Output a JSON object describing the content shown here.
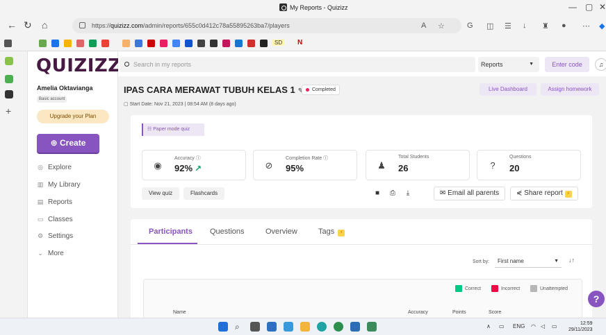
{
  "browser": {
    "window_title": "My Reports - Quizizz",
    "url_prefix": "https://",
    "url_host": "quizizz.com",
    "url_path": "/admin/reports/655c0d412c78a55895263ba7/players",
    "bookmark_sd": "SD",
    "bookmark_n": "N"
  },
  "sidebar": {
    "logo": "QUIZIZZ",
    "username": "Amelia Oktavianga",
    "account_type": "Basic account",
    "upgrade_label": "Upgrade your Plan",
    "create_label": "Create",
    "nav": [
      {
        "label": "Explore",
        "icon": "compass-icon"
      },
      {
        "label": "My Library",
        "icon": "library-icon"
      },
      {
        "label": "Reports",
        "icon": "reports-icon"
      },
      {
        "label": "Classes",
        "icon": "classes-icon"
      },
      {
        "label": "Settings",
        "icon": "gear-icon"
      },
      {
        "label": "More",
        "icon": "chevron-down-icon"
      }
    ]
  },
  "topbar": {
    "search_placeholder": "Search in my reports",
    "scope_value": "Reports",
    "enter_code_label": "Enter code"
  },
  "report": {
    "title": "IPAS CARA MERAWAT TUBUH KELAS 1",
    "status": "Completed",
    "start_date": "Start Date:  Nov 21, 2023 | 08:54 AM (8 days ago)",
    "live_dashboard_label": "Live Dashboard",
    "assign_homework_label": "Assign homework",
    "mode_chip": "Paper mode quiz",
    "stats": [
      {
        "label": "Accuracy",
        "value": "92%",
        "icon": "target-icon"
      },
      {
        "label": "Completion Rate",
        "value": "95%",
        "icon": "check-circle-icon"
      },
      {
        "label": "Total Students",
        "value": "26",
        "icon": "students-icon"
      },
      {
        "label": "Questions",
        "value": "20",
        "icon": "question-icon"
      }
    ],
    "view_quiz_label": "View quiz",
    "flashcards_label": "Flashcards",
    "email_parents_label": "Email all parents",
    "share_report_label": "Share report"
  },
  "tabs": [
    {
      "label": "Participants",
      "active": true
    },
    {
      "label": "Questions",
      "active": false
    },
    {
      "label": "Overview",
      "active": false
    },
    {
      "label": "Tags",
      "active": false
    }
  ],
  "participants": {
    "sort_label": "Sort by:",
    "sort_value": "First name",
    "legend": [
      {
        "label": "Correct",
        "color": "#00c985"
      },
      {
        "label": "Incorrect",
        "color": "#ec0b43"
      },
      {
        "label": "Unattempted",
        "color": "#b6b6b6"
      }
    ],
    "columns": [
      "Name",
      "Accuracy",
      "Points",
      "Score"
    ]
  },
  "taskbar": {
    "lang": "ENG",
    "time": "12:59",
    "date": "29/11/2023"
  },
  "colors": {
    "brand_purple": "#8854c0",
    "logo": "#461a42",
    "status_dot": "#e4245b"
  }
}
